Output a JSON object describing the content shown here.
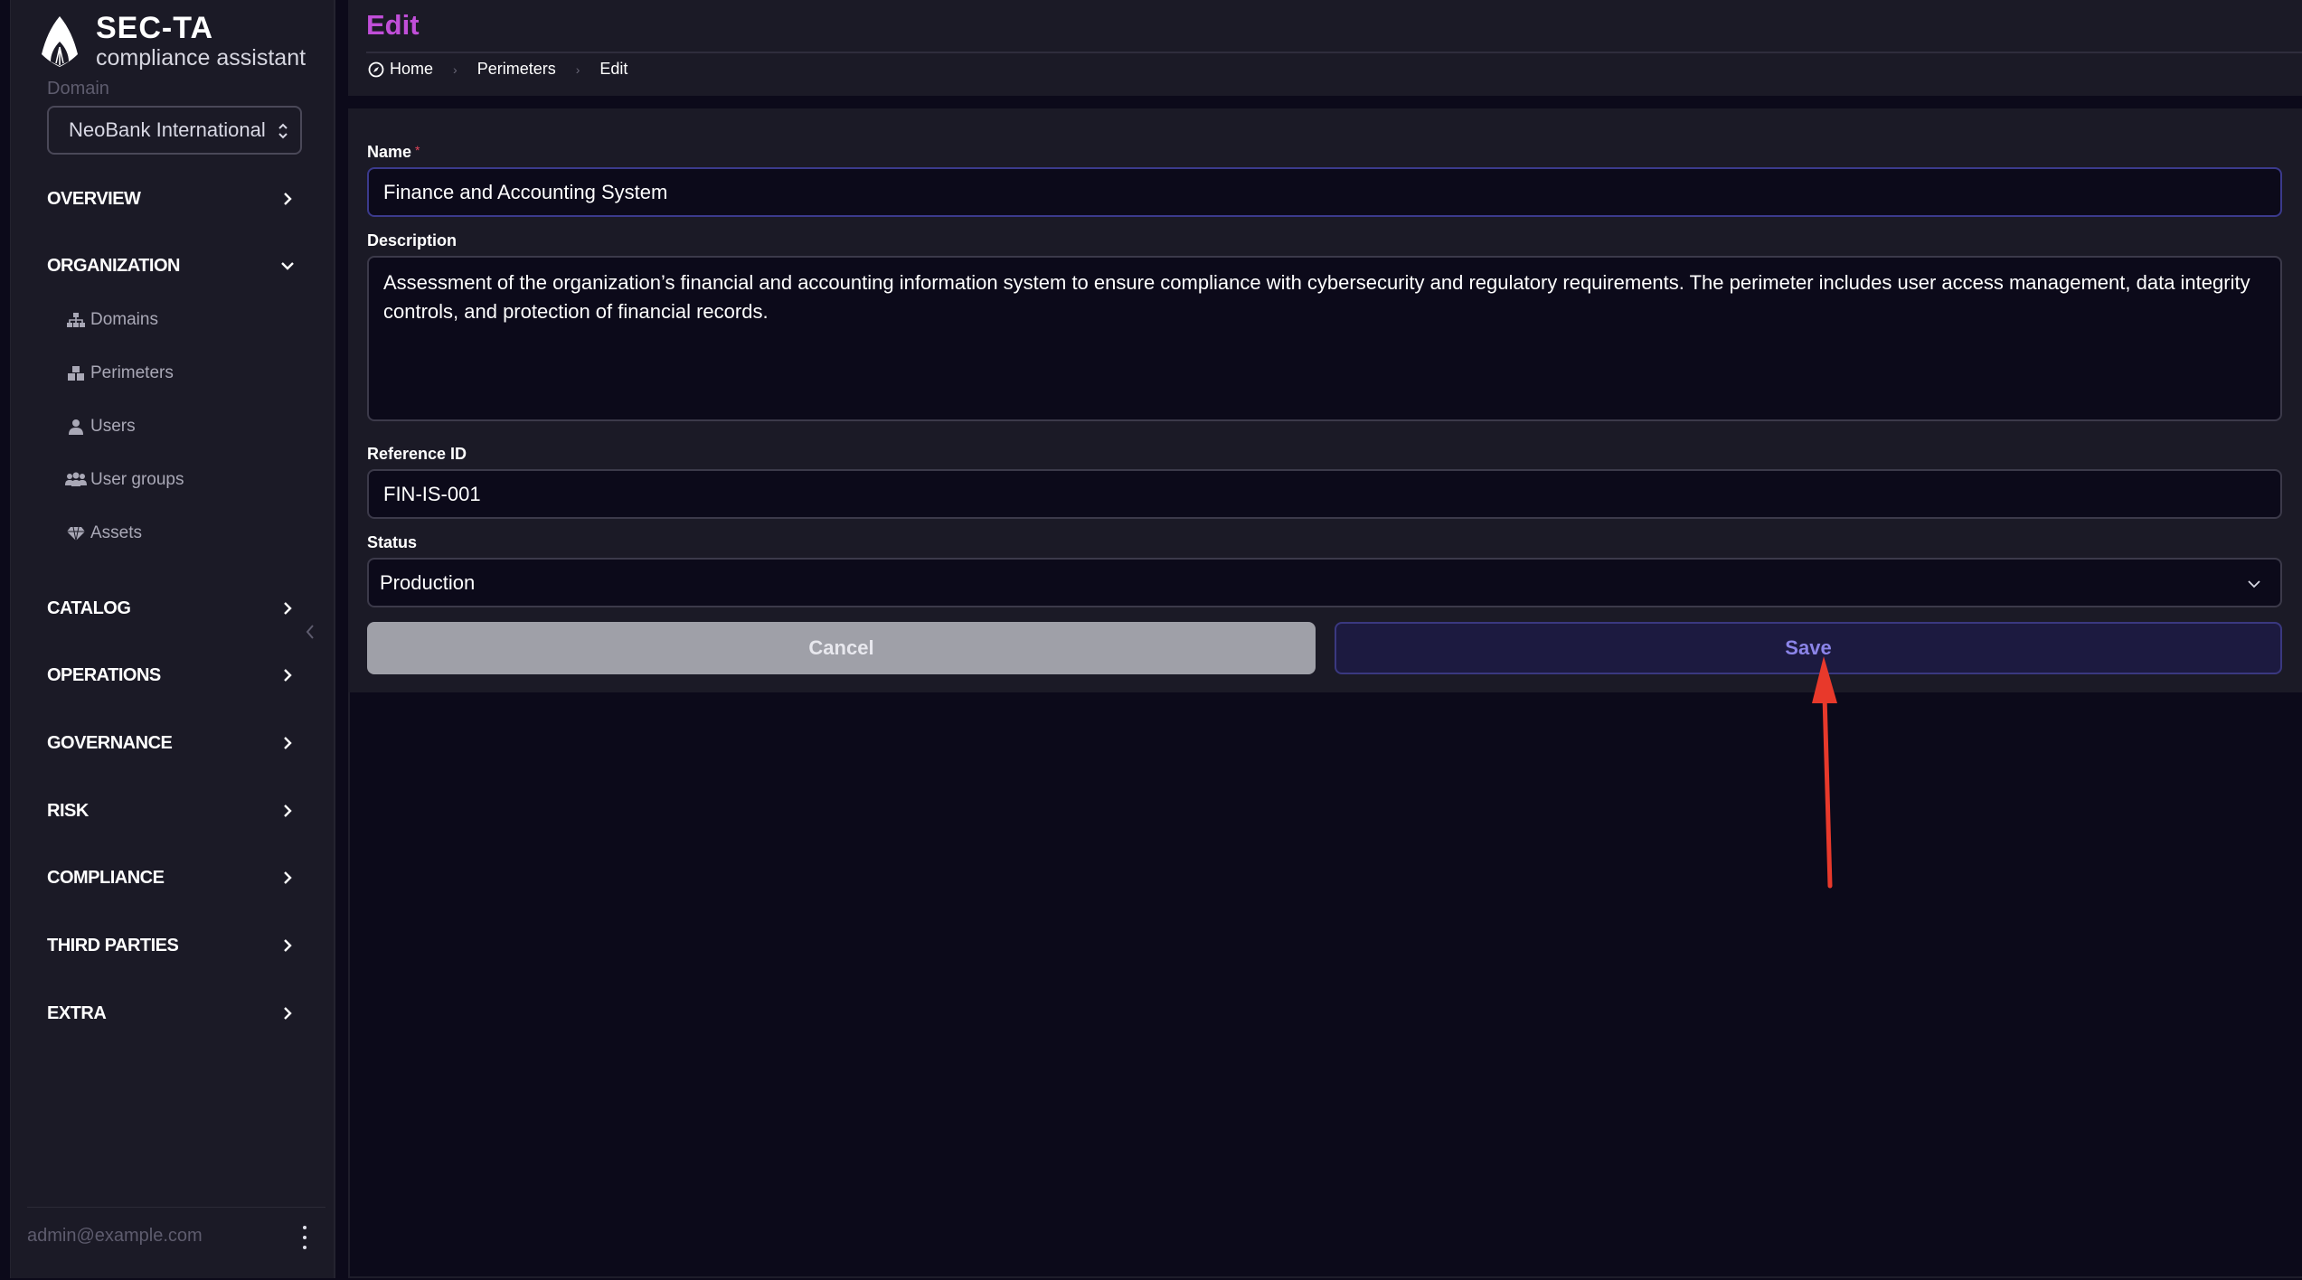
{
  "brand": {
    "title": "SEC-TA",
    "subtitle": "compliance assistant"
  },
  "domain": {
    "label": "Domain",
    "selected": "NeoBank International"
  },
  "nav": {
    "overview": "OVERVIEW",
    "organization": "ORGANIZATION",
    "organization_items": [
      {
        "label": "Domains",
        "icon": "sitemap-icon"
      },
      {
        "label": "Perimeters",
        "icon": "cubes-icon"
      },
      {
        "label": "Users",
        "icon": "user-icon"
      },
      {
        "label": "User groups",
        "icon": "users-icon"
      },
      {
        "label": "Assets",
        "icon": "gem-icon"
      }
    ],
    "catalog": "CATALOG",
    "operations": "OPERATIONS",
    "governance": "GOVERNANCE",
    "risk": "RISK",
    "compliance": "COMPLIANCE",
    "third_parties": "THIRD PARTIES",
    "extra": "EXTRA"
  },
  "user": {
    "email": "admin@example.com"
  },
  "header": {
    "title": "Edit",
    "breadcrumb": [
      "Home",
      "Perimeters",
      "Edit"
    ]
  },
  "form": {
    "name_label": "Name",
    "name_required_mark": "*",
    "name_value": "Finance and Accounting System",
    "description_label": "Description",
    "description_value": "Assessment of the organization’s financial and accounting information system to ensure compliance with cybersecurity and regulatory requirements. The perimeter includes user access management, data integrity controls, and protection of financial records.",
    "reference_label": "Reference ID",
    "reference_value": "FIN-IS-001",
    "status_label": "Status",
    "status_value": "Production",
    "cancel_label": "Cancel",
    "save_label": "Save"
  },
  "colors": {
    "accent_title": "#c04ed8",
    "save_text": "#8b84e8",
    "annotation_arrow": "#e8392b"
  }
}
